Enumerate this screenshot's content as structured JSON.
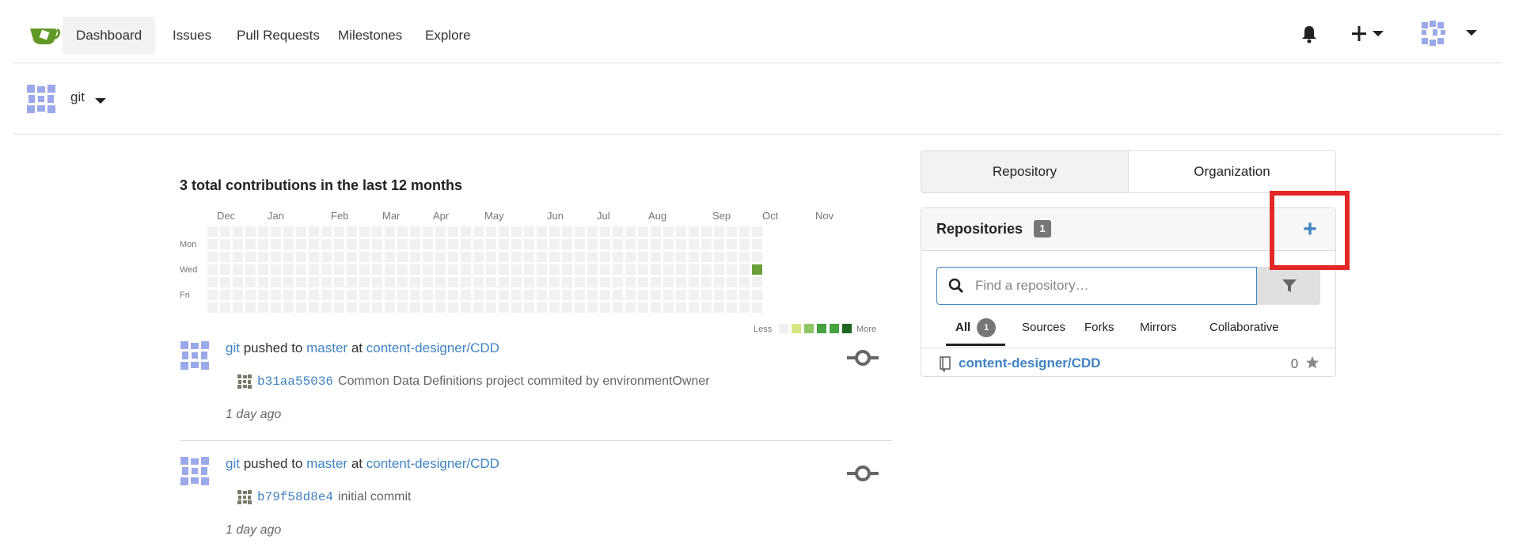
{
  "nav": {
    "items": [
      {
        "label": "Dashboard",
        "active": true
      },
      {
        "label": "Issues"
      },
      {
        "label": "Pull Requests"
      },
      {
        "label": "Milestones"
      },
      {
        "label": "Explore"
      }
    ]
  },
  "context": {
    "user": "git"
  },
  "contributions": {
    "title": "3 total contributions in the last 12 months",
    "months": [
      "Dec",
      "Jan",
      "Feb",
      "Mar",
      "Apr",
      "May",
      "Jun",
      "Jul",
      "Aug",
      "Sep",
      "Oct",
      "Nov"
    ],
    "days": [
      "Mon",
      "Wed",
      "Fri"
    ],
    "legend_less": "Less",
    "legend_more": "More",
    "colors": {
      "empty": "#f1f1f1",
      "l1": "#d6e685",
      "l2": "#8cc665",
      "l3": "#44a340",
      "l4": "#1e6823",
      "active": "#6a9f3a"
    }
  },
  "feed": [
    {
      "user": "git",
      "action": "pushed to",
      "branch": "master",
      "at": "at",
      "repo": "content-designer/CDD",
      "sha": "b31aa55036",
      "message": "Common Data Definitions project commited by environmentOwner",
      "time": "1 day ago"
    },
    {
      "user": "git",
      "action": "pushed to",
      "branch": "master",
      "at": "at",
      "repo": "content-designer/CDD",
      "sha": "b79f58d8e4",
      "message": "initial commit",
      "time": "1 day ago"
    }
  ],
  "panel": {
    "tabs": [
      "Repository",
      "Organization"
    ],
    "title": "Repositories",
    "count": "1",
    "add_label": "+",
    "search_placeholder": "Find a repository…",
    "filters": [
      {
        "label": "All",
        "count": "1",
        "active": true
      },
      {
        "label": "Sources"
      },
      {
        "label": "Forks"
      },
      {
        "label": "Mirrors"
      },
      {
        "label": "Collaborative"
      }
    ],
    "repos": [
      {
        "name": "content-designer/CDD",
        "stars": "0"
      }
    ]
  },
  "theme": {
    "link": "#4183c4",
    "highlight": "#e42626"
  }
}
